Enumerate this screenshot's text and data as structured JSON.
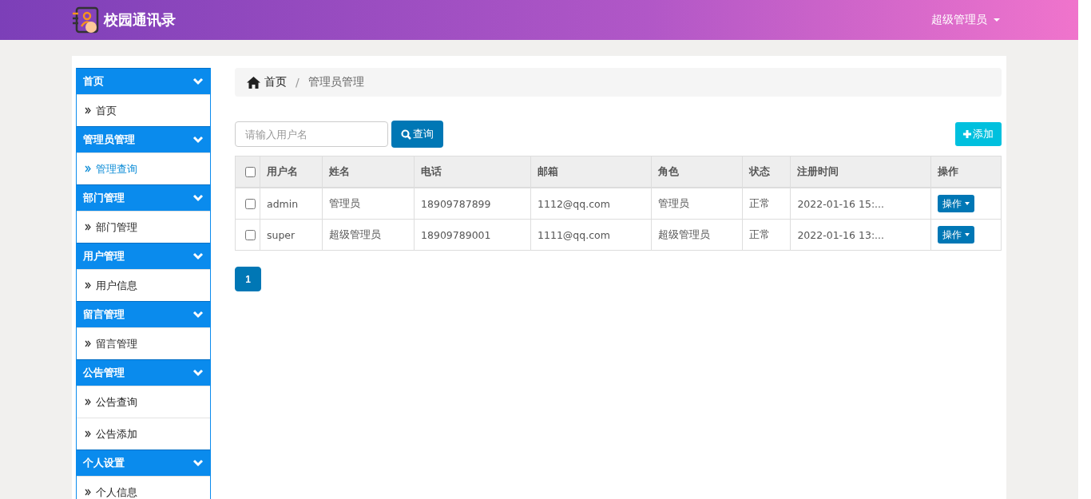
{
  "header": {
    "logo_text": "校园通讯录",
    "user_menu": "超级管理员"
  },
  "sidebar": {
    "groups": [
      {
        "title": "首页",
        "items": [
          {
            "label": "首页",
            "selected": false
          }
        ]
      },
      {
        "title": "管理员管理",
        "items": [
          {
            "label": "管理查询",
            "selected": true
          }
        ]
      },
      {
        "title": "部门管理",
        "items": [
          {
            "label": "部门管理",
            "selected": false
          }
        ]
      },
      {
        "title": "用户管理",
        "items": [
          {
            "label": "用户信息",
            "selected": false
          }
        ]
      },
      {
        "title": "留言管理",
        "items": [
          {
            "label": "留言管理",
            "selected": false
          }
        ]
      },
      {
        "title": "公告管理",
        "items": [
          {
            "label": "公告查询",
            "selected": false
          },
          {
            "label": "公告添加",
            "selected": false
          }
        ]
      },
      {
        "title": "个人设置",
        "items": [
          {
            "label": "个人信息",
            "selected": false
          }
        ]
      }
    ]
  },
  "breadcrumb": [
    "首页",
    "管理员管理"
  ],
  "breadcrumb_separator": "/",
  "search": {
    "placeholder": "请输入用户名",
    "button": "查询"
  },
  "add_button": "添加",
  "table": {
    "select_all_checked": false,
    "columns": [
      "用户名",
      "姓名",
      "电话",
      "邮箱",
      "角色",
      "状态",
      "注册时间",
      "操作"
    ],
    "rows": [
      {
        "checked": false,
        "cells": [
          "admin",
          "管理员",
          "18909787899",
          "1112@qq.com",
          "管理员",
          "正常",
          "2022-01-16 15:..."
        ],
        "action": "操作"
      },
      {
        "checked": false,
        "cells": [
          "super",
          "超级管理员",
          "18909789001",
          "1111@qq.com",
          "超级管理员",
          "正常",
          "2022-01-16 13:..."
        ],
        "action": "操作"
      }
    ]
  },
  "pagination": [
    {
      "label": "1",
      "selected": true
    }
  ]
}
